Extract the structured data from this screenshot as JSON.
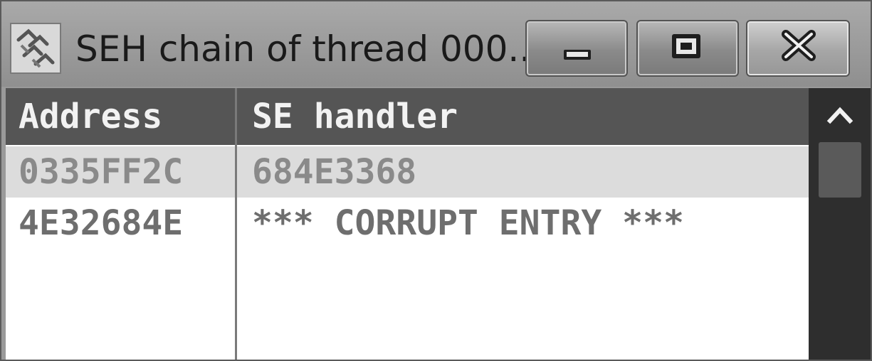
{
  "window": {
    "title": "SEH chain of thread 000...",
    "icon": "seh-chain-icon"
  },
  "caption_buttons": {
    "minimize_icon": "minimize-icon",
    "maximize_icon": "maximize-icon",
    "close_icon": "close-icon"
  },
  "table": {
    "columns": [
      "Address",
      "SE handler"
    ],
    "rows": [
      {
        "address": "0335FF2C",
        "handler": "684E3368",
        "selected": true
      },
      {
        "address": "4E32684E",
        "handler": "*** CORRUPT ENTRY ***",
        "selected": false
      }
    ]
  },
  "scrollbar": {
    "up_icon": "chevron-up-icon"
  },
  "colors": {
    "header_bg": "#555555",
    "selected_row_bg": "#dcdcdc",
    "scrollbar_bg": "#2e2e2e"
  }
}
